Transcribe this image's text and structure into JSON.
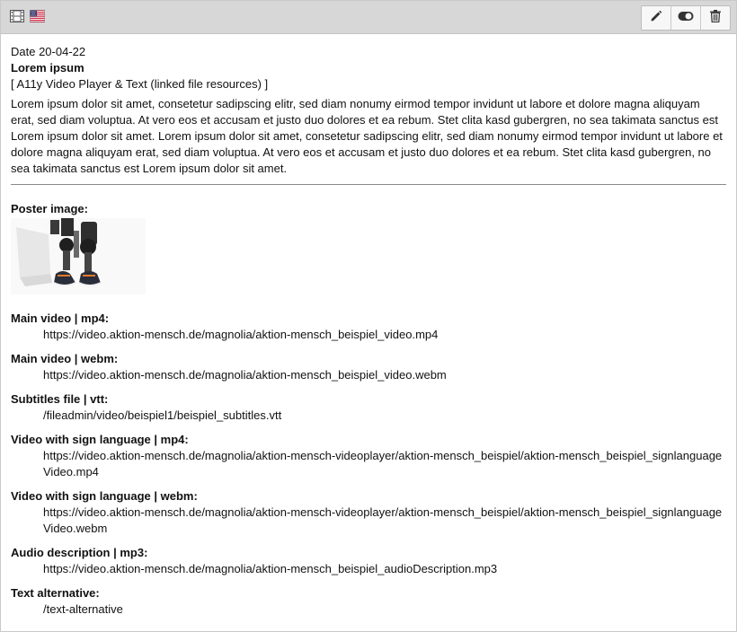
{
  "header": {
    "icons": [
      "film-icon",
      "us-flag-icon"
    ],
    "buttons": [
      "edit-icon",
      "toggle-icon",
      "trash-icon"
    ]
  },
  "content": {
    "date": "Date 20-04-22",
    "title": "Lorem ipsum",
    "type_label": "[ A11y Video Player & Text (linked file resources) ]",
    "description": "Lorem ipsum dolor sit amet, consetetur sadipscing elitr, sed diam nonumy eirmod tempor invidunt ut labore et dolore magna aliquyam erat, sed diam voluptua. At vero eos et accusam et justo duo dolores et ea rebum. Stet clita kasd gubergren, no sea takimata sanctus est Lorem ipsum dolor sit amet. Lorem ipsum dolor sit amet, consetetur sadipscing elitr, sed diam nonumy eirmod tempor invidunt ut labore et dolore magna aliquyam erat, sed diam voluptua. At vero eos et accusam et justo duo dolores et ea rebum. Stet clita kasd gubergren, no sea takimata sanctus est Lorem ipsum dolor sit amet.",
    "poster_label": "Poster image:"
  },
  "fields": [
    {
      "label": "Main video | mp4:",
      "value": "https://video.aktion-mensch.de/magnolia/aktion-mensch_beispiel_video.mp4"
    },
    {
      "label": "Main video | webm:",
      "value": "https://video.aktion-mensch.de/magnolia/aktion-mensch_beispiel_video.webm"
    },
    {
      "label": "Subtitles file | vtt:",
      "value": "/fileadmin/video/beispiel1/beispiel_subtitles.vtt"
    },
    {
      "label": "Video with sign language | mp4:",
      "value": "https://video.aktion-mensch.de/magnolia/aktion-mensch-videoplayer/aktion-mensch_beispiel/aktion-mensch_beispiel_signlanguageVideo.mp4"
    },
    {
      "label": "Video with sign language | webm:",
      "value": "https://video.aktion-mensch.de/magnolia/aktion-mensch-videoplayer/aktion-mensch_beispiel/aktion-mensch_beispiel_signlanguageVideo.webm"
    },
    {
      "label": "Audio description | mp3:",
      "value": "https://video.aktion-mensch.de/magnolia/aktion-mensch_beispiel_audioDescription.mp3"
    },
    {
      "label": "Text alternative:",
      "value": "/text-alternative"
    }
  ]
}
